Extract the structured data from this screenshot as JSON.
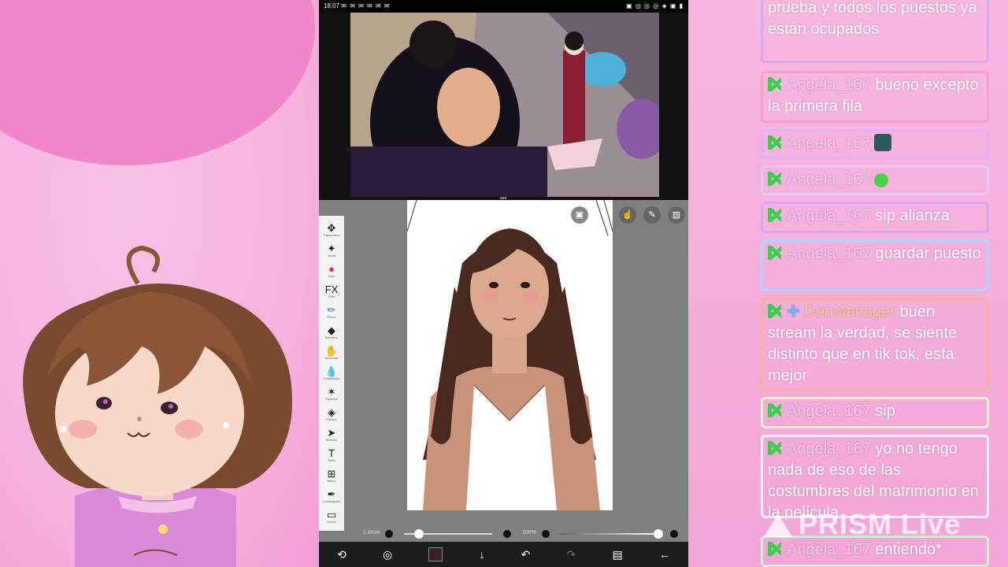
{
  "status_bar": {
    "time": "18:07",
    "left_icons": "✉ ✉ ✉ ✉ ✉ ✉",
    "right_icons": "▣ ◎ ◎ ◎ ◈ ▣ ▮"
  },
  "toolbar": {
    "tools": [
      {
        "icon": "move-icon",
        "glyph": "✥",
        "label": "Transformar"
      },
      {
        "icon": "magic-wand-icon",
        "glyph": "✦",
        "label": "Varita"
      },
      {
        "icon": "live-icon",
        "glyph": "●",
        "label": "Lazo"
      },
      {
        "icon": "fx-icon",
        "glyph": "FX",
        "label": "Filtro"
      },
      {
        "icon": "brush-icon",
        "glyph": "✏",
        "label": "Pincel"
      },
      {
        "icon": "eraser-icon",
        "glyph": "◆",
        "label": "Borrador"
      },
      {
        "icon": "smudge-icon",
        "glyph": "✋",
        "label": "Difuminar"
      },
      {
        "icon": "blur-icon",
        "glyph": "💧",
        "label": "Desenfocar"
      },
      {
        "icon": "special-icon",
        "glyph": "✶",
        "label": "Especial"
      },
      {
        "icon": "fill-icon",
        "glyph": "◈",
        "label": "Relleno"
      },
      {
        "icon": "select-icon",
        "glyph": "➤",
        "label": "Selector"
      },
      {
        "icon": "text-icon",
        "glyph": "T",
        "label": "Texto"
      },
      {
        "icon": "frame-icon",
        "glyph": "⊞",
        "label": "Marco"
      },
      {
        "icon": "eyedropper-icon",
        "glyph": "✒",
        "label": "Cuentagotas"
      },
      {
        "icon": "canvas-icon",
        "glyph": "▭",
        "label": "Lienzo"
      }
    ]
  },
  "sliders": {
    "size_label": "1.8mm",
    "opacity_label": "100%"
  },
  "chat": {
    "messages": [
      {
        "user": "",
        "text": "prueba y todos los puestos ya están ocupados"
      },
      {
        "user": "Angela_167",
        "text": "bueno excepto la primera fila"
      },
      {
        "user": "Angela_167",
        "text": ""
      },
      {
        "user": "Angela_167",
        "text": ""
      },
      {
        "user": "Angela_167",
        "text": "sip alianza"
      },
      {
        "user": "Angela_167",
        "text": "guardar puesto"
      },
      {
        "user": "DonManager",
        "text": "buen stream la verdad, se siente distinto que en tik tok, esta mejor"
      },
      {
        "user": "Angela_167",
        "text": "sip"
      },
      {
        "user": "Angela_167",
        "text": "yo no tengo nada de eso de las costumbres del matrimonio en la película"
      },
      {
        "user": "Angela_167",
        "text": "entiendo*"
      }
    ]
  },
  "watermark": "PRISM Live",
  "colors": {
    "chat_border_1": "#d7a6f4",
    "chat_border_2": "#f7a0c8",
    "chat_border_3": "#a8d8ff",
    "kick_green": "#3ad14a"
  }
}
